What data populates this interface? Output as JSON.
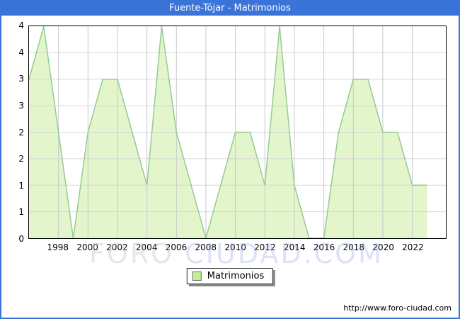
{
  "header": {
    "title": "Fuente-Tójar - Matrimonios"
  },
  "legend": {
    "label": "Matrimonios"
  },
  "watermark": {
    "part1": "FORO ",
    "part2": "CIUDAD.COM"
  },
  "footer": {
    "url": "http://www.foro-ciudad.com"
  },
  "colors": {
    "accent_blue": "#3b74d8",
    "area_fill": "#e2f5cb",
    "area_line": "#93cc93",
    "grid_horizontal": "#d8d8d8",
    "grid_vertical": "#c9c9cd",
    "legend_swatch": "#c3ee96"
  },
  "chart_data": {
    "type": "area",
    "title": "Fuente-Tójar - Matrimonios",
    "x": [
      1996,
      1997,
      1998,
      1999,
      2000,
      2001,
      2002,
      2003,
      2004,
      2005,
      2006,
      2007,
      2008,
      2009,
      2010,
      2011,
      2012,
      2013,
      2014,
      2015,
      2016,
      2017,
      2018,
      2019,
      2020,
      2021,
      2022,
      2023
    ],
    "series": [
      {
        "name": "Matrimonios",
        "values": [
          3,
          4,
          2,
          0,
          2,
          3,
          3,
          2,
          1,
          4,
          2,
          1,
          0,
          1,
          2,
          2,
          1,
          4,
          1,
          0,
          0,
          2,
          3,
          3,
          2,
          2,
          1,
          1
        ]
      }
    ],
    "ylim": [
      0,
      4
    ],
    "xlabel": "",
    "ylabel": "",
    "xticks": [
      1998,
      2000,
      2002,
      2004,
      2006,
      2008,
      2010,
      2012,
      2014,
      2016,
      2018,
      2020,
      2022
    ],
    "yticks": {
      "values": [
        4,
        3.5,
        3,
        2.5,
        2,
        1.5,
        1,
        0.5,
        0
      ],
      "labels": [
        "4",
        "4",
        "3",
        "3",
        "2",
        "2",
        "1",
        "1",
        "0"
      ]
    },
    "grid": true,
    "legend_position": "bottom-center"
  }
}
